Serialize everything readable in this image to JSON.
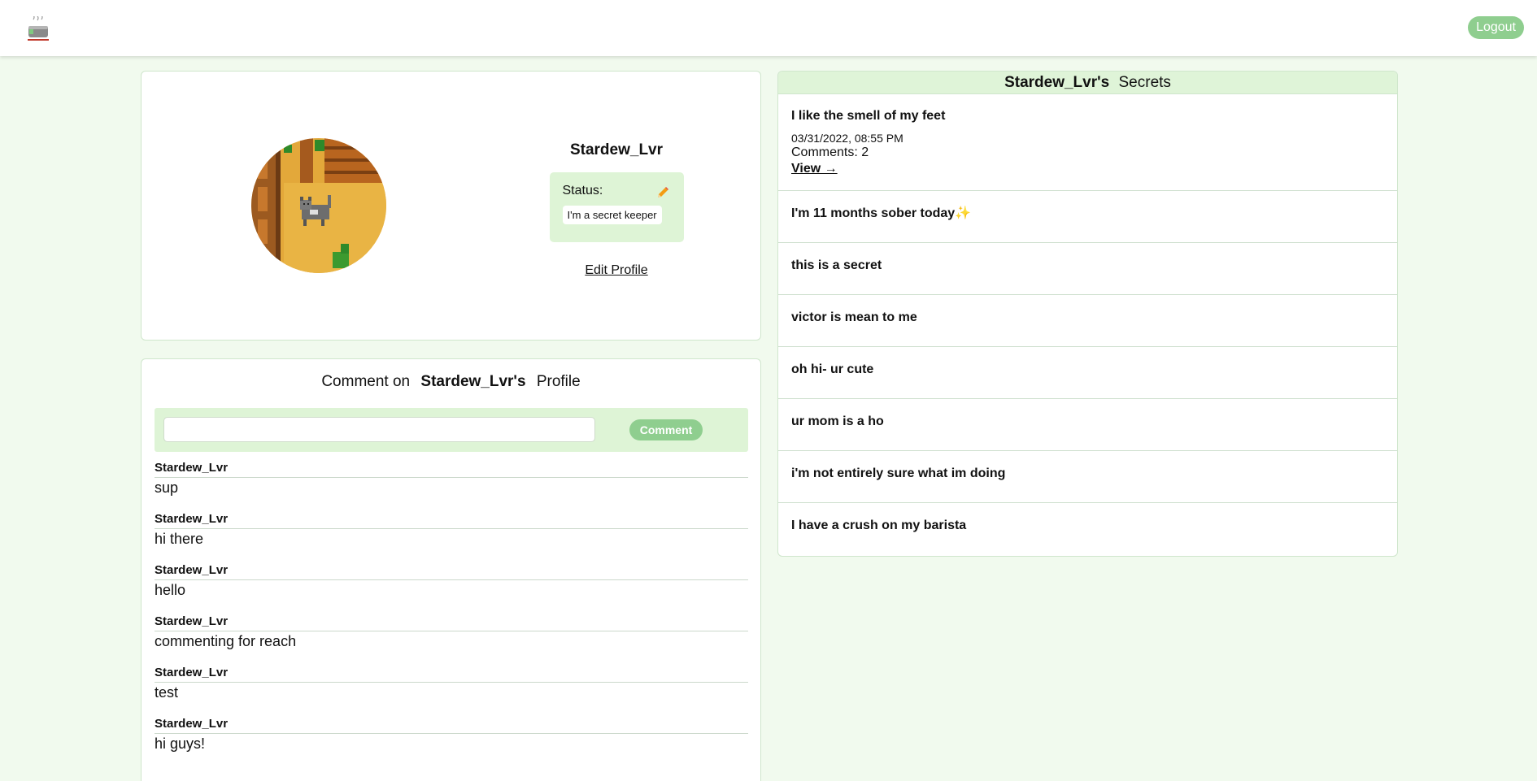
{
  "nav": {
    "logo_icon": "teapot-icon",
    "logout_label": "Logout"
  },
  "profile": {
    "username": "Stardew_Lvr",
    "status_label": "Status:",
    "status_value": "I'm a secret keeper",
    "edit_profile_label": "Edit Profile",
    "avatar_icon": "pixel-cat-avatar"
  },
  "comment_section": {
    "title_prefix": "Comment on",
    "title_name": "Stardew_Lvr's",
    "title_suffix": "Profile",
    "input_placeholder": "",
    "button_label": "Comment",
    "comments": [
      {
        "author": "Stardew_Lvr",
        "text": "sup"
      },
      {
        "author": "Stardew_Lvr",
        "text": "hi there"
      },
      {
        "author": "Stardew_Lvr",
        "text": "hello"
      },
      {
        "author": "Stardew_Lvr",
        "text": "commenting for reach"
      },
      {
        "author": "Stardew_Lvr",
        "text": "test"
      },
      {
        "author": "Stardew_Lvr",
        "text": "hi guys!"
      }
    ]
  },
  "secrets": {
    "header_name": "Stardew_Lvr's",
    "header_suffix": "Secrets",
    "items": [
      {
        "title": "I like the smell of my feet",
        "date": "03/31/2022, 08:55 PM",
        "comments": "Comments: 2",
        "view": "View →"
      },
      {
        "title": "I'm 11 months sober today",
        "sparkle": "✨"
      },
      {
        "title": "this is a secret"
      },
      {
        "title": "victor is mean to me"
      },
      {
        "title": "oh hi- ur cute"
      },
      {
        "title": "ur mom is a ho"
      },
      {
        "title": "i'm not entirely sure what im doing"
      },
      {
        "title": "I have a crush on my barista"
      }
    ]
  },
  "colors": {
    "background": "#f1faee",
    "accent": "#8fce8f",
    "panel_tint": "#def4d6"
  }
}
